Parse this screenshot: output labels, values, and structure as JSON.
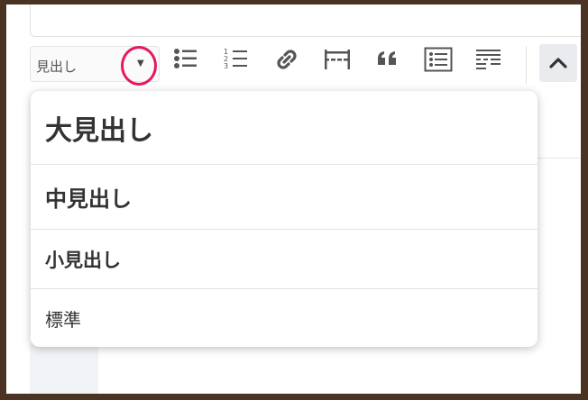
{
  "toolbar": {
    "heading_select": {
      "value": "見出し"
    },
    "buttons": [
      {
        "name": "bullet-list",
        "icon": "bullet-list-icon"
      },
      {
        "name": "numbered-list",
        "icon": "numbered-list-icon"
      },
      {
        "name": "link",
        "icon": "link-icon"
      },
      {
        "name": "horizontal-rule",
        "icon": "horizontal-rule-icon"
      },
      {
        "name": "blockquote",
        "icon": "quote-icon"
      },
      {
        "name": "box",
        "icon": "list-box-icon"
      },
      {
        "name": "more",
        "icon": "read-more-icon"
      }
    ],
    "collapse": {
      "icon": "chevron-up-icon"
    }
  },
  "dropdown": {
    "options": [
      {
        "label": "大見出し"
      },
      {
        "label": "中見出し"
      },
      {
        "label": "小見出し"
      },
      {
        "label": "標準"
      }
    ]
  },
  "colors": {
    "frame": "#4a3322",
    "highlight": "#e6195f",
    "icon": "#555555",
    "text": "#333333"
  }
}
